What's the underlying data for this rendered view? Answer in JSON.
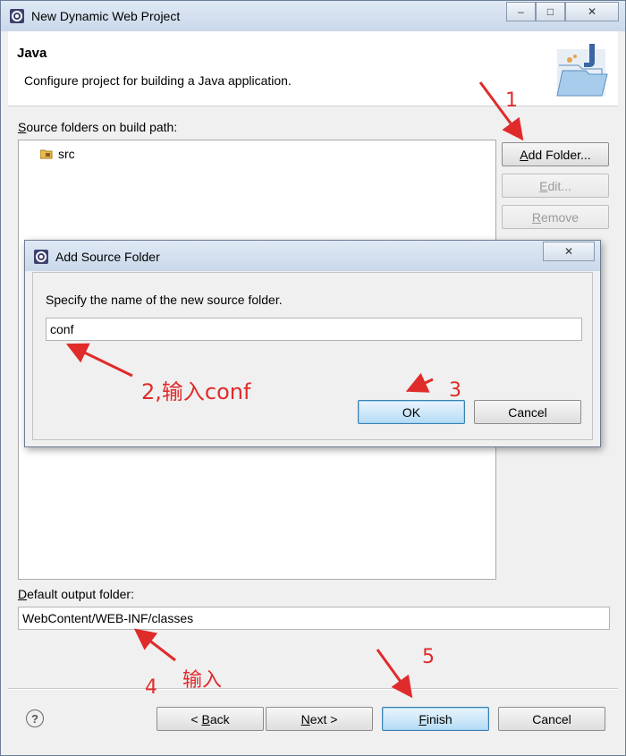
{
  "window": {
    "title": "New Dynamic Web Project",
    "minimize_glyph": "‒",
    "maximize_glyph": "□",
    "close_glyph": "✕"
  },
  "header": {
    "title": "Java",
    "description": "Configure project for building a Java application."
  },
  "source_folders": {
    "label_u": "S",
    "label_rest": "ource folders on build path:",
    "items": [
      {
        "name": "src",
        "icon": "package-folder-icon"
      }
    ]
  },
  "buttons": {
    "add_folder": {
      "u": "A",
      "rest": "dd Folder..."
    },
    "edit": {
      "u": "E",
      "rest": "dit..."
    },
    "remove": {
      "u": "R",
      "rest": "emove"
    }
  },
  "output": {
    "label_u": "D",
    "label_rest": "efault output folder:",
    "value": "WebContent/WEB-INF/classes"
  },
  "footer": {
    "help_glyph": "?",
    "back": {
      "pre": "< ",
      "u": "B",
      "rest": "ack"
    },
    "next": {
      "u": "N",
      "rest": "ext >"
    },
    "finish": {
      "u": "F",
      "rest": "inish"
    },
    "cancel": "Cancel"
  },
  "dialog": {
    "title": "Add Source Folder",
    "close_glyph": "✕",
    "prompt": "Specify the name of the new source folder.",
    "input_value": "conf",
    "ok": "OK",
    "cancel": "Cancel"
  },
  "annotations": {
    "step1": "1",
    "step2": "2,输入conf",
    "step3": "3",
    "step4_num": "4",
    "step4_text": "输入",
    "step5": "5",
    "color": "#e02b2b"
  }
}
